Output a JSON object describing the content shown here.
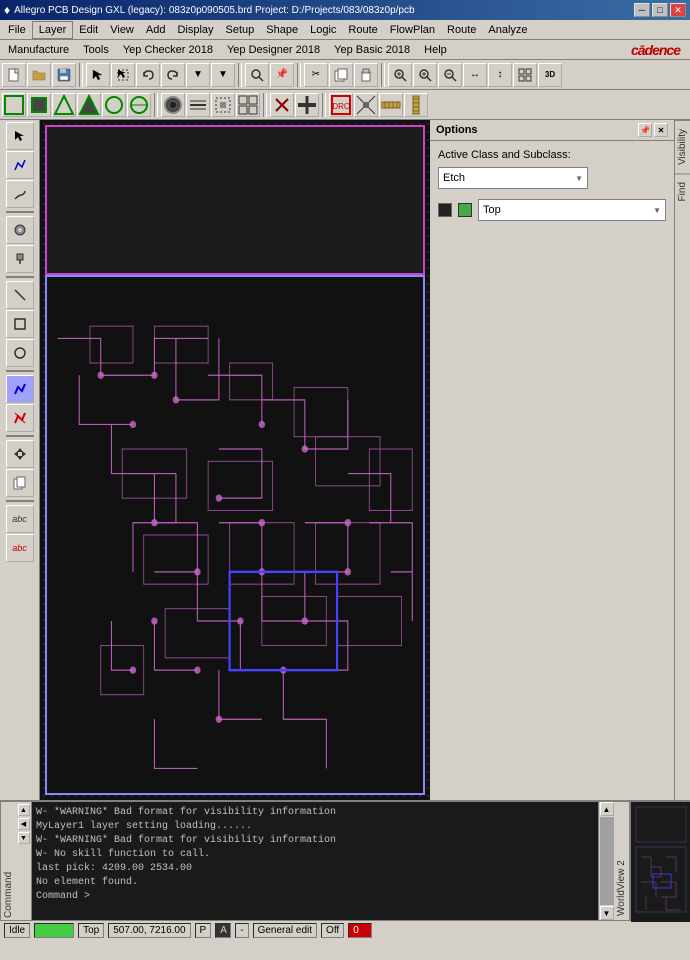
{
  "titlebar": {
    "icon": "♦",
    "title": "Allegro PCB Design GXL (legacy): 083z0p090505.brd  Project: D:/Projects/083/083z0p/pcb",
    "minimize": "─",
    "maximize": "□",
    "close": "✕"
  },
  "menubar1": {
    "items": [
      "File",
      "Layer",
      "Edit",
      "View",
      "Add",
      "Display",
      "Setup",
      "Shape",
      "Logic",
      "Route",
      "FlowPlan",
      "Route",
      "Analyze",
      "Manufacture",
      "Tools",
      "Yep Checker 2018",
      "Yep Designer 2018",
      "Yep Basic 2018",
      "Help"
    ]
  },
  "menubar2": {
    "items": [
      "File",
      "Layer",
      "Edit",
      "View",
      "Add",
      "Display",
      "Setup",
      "Shape",
      "Logic",
      "Route",
      "FlowPlan",
      "Analyze",
      "Manufacture",
      "Tools",
      "Yep Checker 2018",
      "Yep Designer 2018",
      "Yep Basic 2018",
      "Help"
    ],
    "logo": "cādence"
  },
  "options": {
    "title": "Options",
    "active_class_label": "Active Class and Subclass:",
    "class_value": "Etch",
    "subclass_value": "Top",
    "pin_btn": "📌",
    "close_btn": "✕"
  },
  "right_tabs": {
    "visibility": "Visibility",
    "find": "Find"
  },
  "console": {
    "lines": [
      "W- *WARNING* Bad format for visibility information",
      "MyLayer1 layer setting loading......",
      "W- *WARNING* Bad format for visibility information",
      "W- No skill function to call.",
      "last pick:  4209.00 2534.00",
      "No element found.",
      "Command >"
    ]
  },
  "statusbar": {
    "mode": "Idle",
    "indicator": "",
    "layer": "Top",
    "coords": "507.00, 7216.00",
    "p_indicator": "P",
    "a_indicator": "A",
    "dash": "-",
    "edit_mode": "General edit",
    "off": "Off",
    "error_code": "0"
  },
  "toolbar": {
    "buttons": [
      "📂",
      "💾",
      "🖊",
      "❌",
      "↩",
      "↪",
      "⬇",
      "⬇",
      "🔍",
      "📌",
      "✂",
      "📋",
      "🔄",
      "🔃",
      "🔍",
      "🔎",
      "🔍",
      "🔎",
      "↔",
      "🔄",
      "✂",
      "📋",
      "🖊"
    ]
  }
}
